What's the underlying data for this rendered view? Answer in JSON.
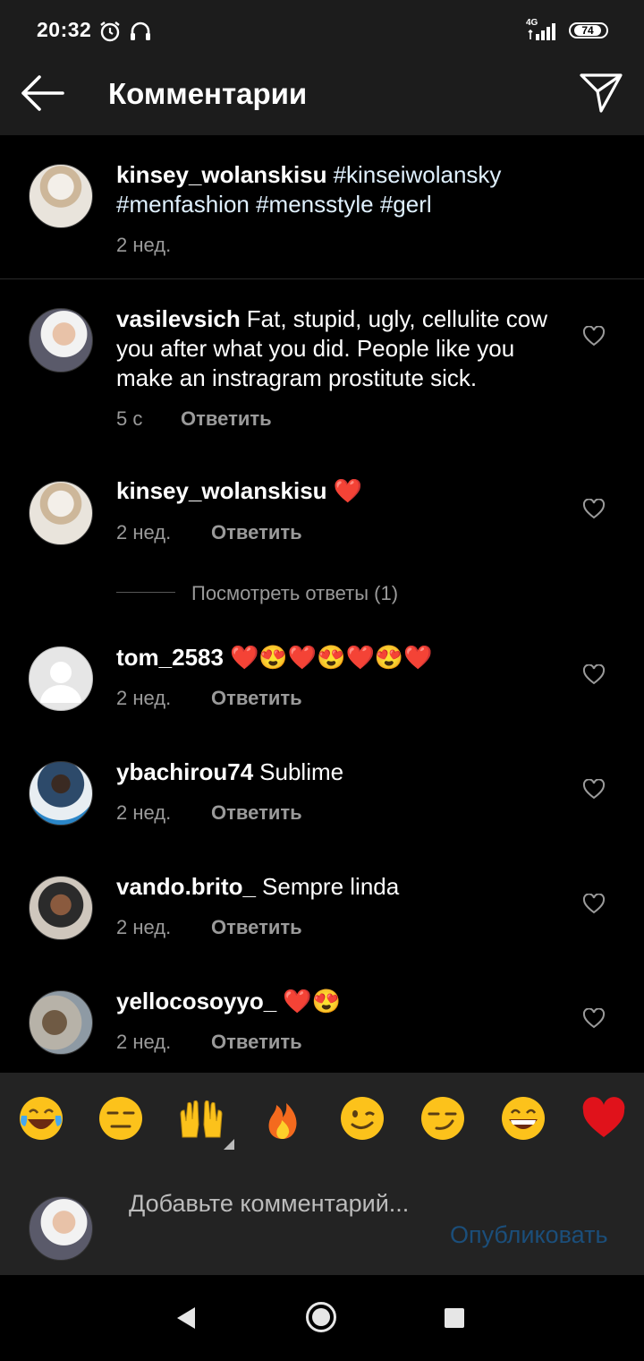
{
  "status_bar": {
    "time": "20:32",
    "network": "4G",
    "battery": "74"
  },
  "header": {
    "title": "Комментарии"
  },
  "caption": {
    "username": "kinsey_wolanskisu",
    "text": "#kinseiwolansky #menfashion #mensstyle #gerl",
    "time": "2 нед."
  },
  "comments": [
    {
      "username": "vasilevsich",
      "text": "Fat, stupid, ugly, cellulite cow you after what you did. People like you make an instragram prostitute sick.",
      "time": "5 с",
      "reply": "Ответить"
    },
    {
      "username": "kinsey_wolanskisu",
      "text": "❤️",
      "time": "2 нед.",
      "reply": "Ответить"
    },
    {
      "username": "tom_2583",
      "text": "❤️😍❤️😍❤️😍❤️",
      "time": "2 нед.",
      "reply": "Ответить"
    },
    {
      "username": "ybachirou74",
      "text": "Sublime",
      "time": "2 нед.",
      "reply": "Ответить"
    },
    {
      "username": "vando.brito_",
      "text": "Sempre linda",
      "time": "2 нед.",
      "reply": "Ответить"
    },
    {
      "username": "yellocosoyyo_",
      "text": "❤️😍",
      "time": "2 нед.",
      "reply": "Ответить"
    }
  ],
  "view_replies": "Посмотреть ответы (1)",
  "quick_emojis": [
    "laughing-tears",
    "expressionless",
    "raised-hands",
    "fire",
    "wink",
    "smirk",
    "grin",
    "red-heart"
  ],
  "composer": {
    "placeholder": "Добавьте комментарий...",
    "publish": "Опубликовать"
  },
  "colors": {
    "background": "#000000",
    "bar": "#1c1c1c",
    "publish_disabled": "#1b4e7a",
    "heart": "#e0121b"
  }
}
